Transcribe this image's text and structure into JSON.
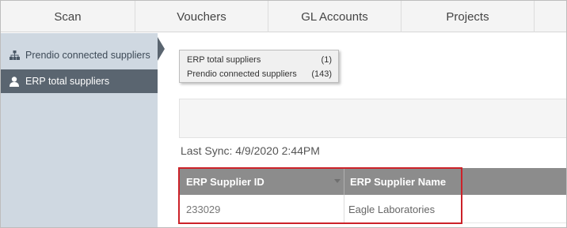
{
  "nav": {
    "tabs": [
      {
        "label": "Scan"
      },
      {
        "label": "Vouchers"
      },
      {
        "label": "GL Accounts"
      },
      {
        "label": "Projects"
      },
      {
        "label": ""
      }
    ]
  },
  "sidebar": {
    "items": [
      {
        "label": "Prendio connected suppliers",
        "icon": "org-chart-icon"
      },
      {
        "label": "ERP total suppliers",
        "icon": "user-icon",
        "active": true
      }
    ]
  },
  "dropdown": {
    "options": [
      {
        "label": "ERP total suppliers",
        "count": "(1)"
      },
      {
        "label": "Prendio connected suppliers",
        "count": "(143)"
      }
    ]
  },
  "last_sync": "Last Sync: 4/9/2020 2:44PM",
  "table": {
    "columns": [
      "ERP Supplier ID",
      "ERP Supplier Name"
    ],
    "rows": [
      [
        "233029",
        "Eagle Laboratories"
      ]
    ]
  },
  "colors": {
    "sidebar_bg": "#cfd8e1",
    "sidebar_active": "#5a6570",
    "header_bg": "#8c8c8c",
    "highlight": "#cc2229"
  }
}
